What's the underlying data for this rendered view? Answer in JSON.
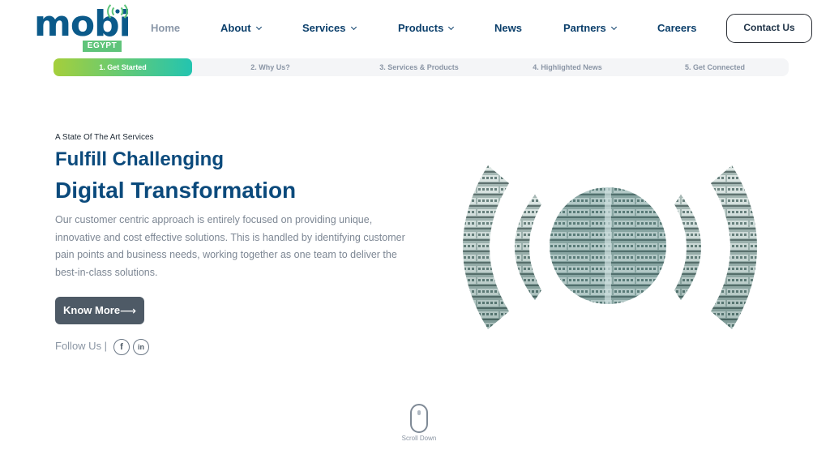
{
  "brand": {
    "name": "mobi",
    "badge": "EGYPT",
    "colors": {
      "primary": "#0b4a7c",
      "accent_green": "#5fc47a",
      "accent_teal": "#23c4b0",
      "accent_lime": "#a5cf3b"
    }
  },
  "nav": {
    "items": [
      {
        "label": "Home",
        "has_dropdown": false,
        "active": true
      },
      {
        "label": "About",
        "has_dropdown": true
      },
      {
        "label": "Services",
        "has_dropdown": true
      },
      {
        "label": "Products",
        "has_dropdown": true
      },
      {
        "label": "News",
        "has_dropdown": false
      },
      {
        "label": "Partners",
        "has_dropdown": true
      },
      {
        "label": "Careers",
        "has_dropdown": false
      }
    ],
    "contact_label": "Contact Us"
  },
  "steps": [
    {
      "label": "1. Get Started",
      "active": true
    },
    {
      "label": "2. Why Us?"
    },
    {
      "label": "3. Services & Products"
    },
    {
      "label": "4. Highlighted News"
    },
    {
      "label": "5. Get Connected"
    }
  ],
  "hero": {
    "eyebrow": "A State Of The Art Services",
    "title_line1": "Fulfill Challenging",
    "title_line2": "Digital Transformation",
    "description": "Our customer centric approach is entirely focused on providing unique, innovative and cost effective solutions. This is handled by identifying customer pain points and business needs, working together as one team to deliver the best-in-class solutions.",
    "cta_label": "Know More",
    "cta_icon": "arrow-right-icon",
    "follow_label": "Follow Us |",
    "social": [
      {
        "icon": "facebook-icon",
        "glyph": "f"
      },
      {
        "icon": "linkedin-icon",
        "glyph": "in"
      }
    ]
  },
  "scroll": {
    "label": "Scroll Down",
    "icon": "mouse-icon"
  }
}
